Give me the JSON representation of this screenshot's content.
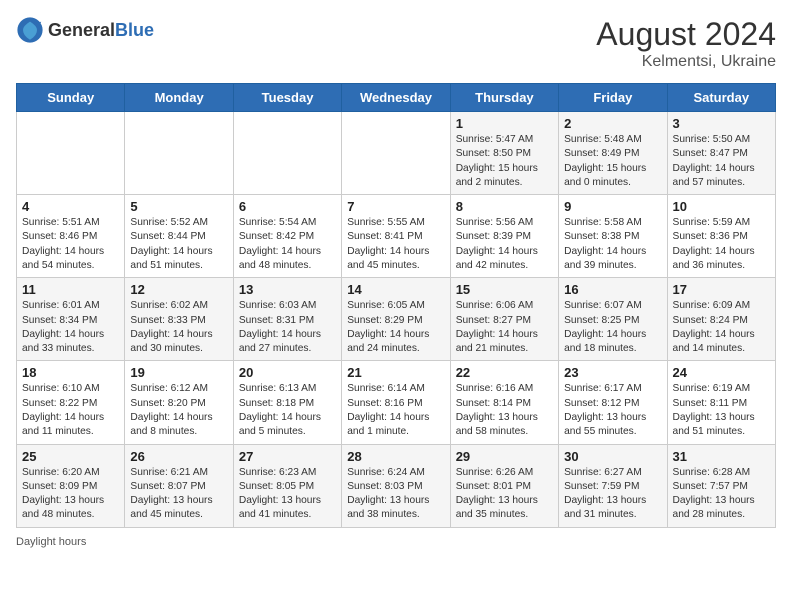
{
  "header": {
    "logo_general": "General",
    "logo_blue": "Blue",
    "month_year": "August 2024",
    "location": "Kelmentsi, Ukraine"
  },
  "days_of_week": [
    "Sunday",
    "Monday",
    "Tuesday",
    "Wednesday",
    "Thursday",
    "Friday",
    "Saturday"
  ],
  "weeks": [
    [
      {
        "day": "",
        "info": ""
      },
      {
        "day": "",
        "info": ""
      },
      {
        "day": "",
        "info": ""
      },
      {
        "day": "",
        "info": ""
      },
      {
        "day": "1",
        "info": "Sunrise: 5:47 AM\nSunset: 8:50 PM\nDaylight: 15 hours and 2 minutes."
      },
      {
        "day": "2",
        "info": "Sunrise: 5:48 AM\nSunset: 8:49 PM\nDaylight: 15 hours and 0 minutes."
      },
      {
        "day": "3",
        "info": "Sunrise: 5:50 AM\nSunset: 8:47 PM\nDaylight: 14 hours and 57 minutes."
      }
    ],
    [
      {
        "day": "4",
        "info": "Sunrise: 5:51 AM\nSunset: 8:46 PM\nDaylight: 14 hours and 54 minutes."
      },
      {
        "day": "5",
        "info": "Sunrise: 5:52 AM\nSunset: 8:44 PM\nDaylight: 14 hours and 51 minutes."
      },
      {
        "day": "6",
        "info": "Sunrise: 5:54 AM\nSunset: 8:42 PM\nDaylight: 14 hours and 48 minutes."
      },
      {
        "day": "7",
        "info": "Sunrise: 5:55 AM\nSunset: 8:41 PM\nDaylight: 14 hours and 45 minutes."
      },
      {
        "day": "8",
        "info": "Sunrise: 5:56 AM\nSunset: 8:39 PM\nDaylight: 14 hours and 42 minutes."
      },
      {
        "day": "9",
        "info": "Sunrise: 5:58 AM\nSunset: 8:38 PM\nDaylight: 14 hours and 39 minutes."
      },
      {
        "day": "10",
        "info": "Sunrise: 5:59 AM\nSunset: 8:36 PM\nDaylight: 14 hours and 36 minutes."
      }
    ],
    [
      {
        "day": "11",
        "info": "Sunrise: 6:01 AM\nSunset: 8:34 PM\nDaylight: 14 hours and 33 minutes."
      },
      {
        "day": "12",
        "info": "Sunrise: 6:02 AM\nSunset: 8:33 PM\nDaylight: 14 hours and 30 minutes."
      },
      {
        "day": "13",
        "info": "Sunrise: 6:03 AM\nSunset: 8:31 PM\nDaylight: 14 hours and 27 minutes."
      },
      {
        "day": "14",
        "info": "Sunrise: 6:05 AM\nSunset: 8:29 PM\nDaylight: 14 hours and 24 minutes."
      },
      {
        "day": "15",
        "info": "Sunrise: 6:06 AM\nSunset: 8:27 PM\nDaylight: 14 hours and 21 minutes."
      },
      {
        "day": "16",
        "info": "Sunrise: 6:07 AM\nSunset: 8:25 PM\nDaylight: 14 hours and 18 minutes."
      },
      {
        "day": "17",
        "info": "Sunrise: 6:09 AM\nSunset: 8:24 PM\nDaylight: 14 hours and 14 minutes."
      }
    ],
    [
      {
        "day": "18",
        "info": "Sunrise: 6:10 AM\nSunset: 8:22 PM\nDaylight: 14 hours and 11 minutes."
      },
      {
        "day": "19",
        "info": "Sunrise: 6:12 AM\nSunset: 8:20 PM\nDaylight: 14 hours and 8 minutes."
      },
      {
        "day": "20",
        "info": "Sunrise: 6:13 AM\nSunset: 8:18 PM\nDaylight: 14 hours and 5 minutes."
      },
      {
        "day": "21",
        "info": "Sunrise: 6:14 AM\nSunset: 8:16 PM\nDaylight: 14 hours and 1 minute."
      },
      {
        "day": "22",
        "info": "Sunrise: 6:16 AM\nSunset: 8:14 PM\nDaylight: 13 hours and 58 minutes."
      },
      {
        "day": "23",
        "info": "Sunrise: 6:17 AM\nSunset: 8:12 PM\nDaylight: 13 hours and 55 minutes."
      },
      {
        "day": "24",
        "info": "Sunrise: 6:19 AM\nSunset: 8:11 PM\nDaylight: 13 hours and 51 minutes."
      }
    ],
    [
      {
        "day": "25",
        "info": "Sunrise: 6:20 AM\nSunset: 8:09 PM\nDaylight: 13 hours and 48 minutes."
      },
      {
        "day": "26",
        "info": "Sunrise: 6:21 AM\nSunset: 8:07 PM\nDaylight: 13 hours and 45 minutes."
      },
      {
        "day": "27",
        "info": "Sunrise: 6:23 AM\nSunset: 8:05 PM\nDaylight: 13 hours and 41 minutes."
      },
      {
        "day": "28",
        "info": "Sunrise: 6:24 AM\nSunset: 8:03 PM\nDaylight: 13 hours and 38 minutes."
      },
      {
        "day": "29",
        "info": "Sunrise: 6:26 AM\nSunset: 8:01 PM\nDaylight: 13 hours and 35 minutes."
      },
      {
        "day": "30",
        "info": "Sunrise: 6:27 AM\nSunset: 7:59 PM\nDaylight: 13 hours and 31 minutes."
      },
      {
        "day": "31",
        "info": "Sunrise: 6:28 AM\nSunset: 7:57 PM\nDaylight: 13 hours and 28 minutes."
      }
    ]
  ],
  "footer": {
    "daylight_label": "Daylight hours"
  }
}
